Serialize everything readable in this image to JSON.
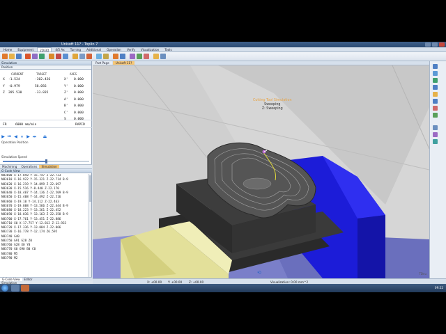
{
  "app": {
    "title": "Unisoft 11? - Toplin 7",
    "document_tab_1": "Part Page",
    "document_tab_2": "Unisoft 11?"
  },
  "ribbon": {
    "tabs": [
      {
        "label": "Home"
      },
      {
        "label": "Equipment"
      },
      {
        "label": "2D/3D"
      },
      {
        "label": "4/5 Ax"
      },
      {
        "label": "Turning"
      },
      {
        "label": "Additional"
      },
      {
        "label": "Operation"
      },
      {
        "label": "Verify"
      },
      {
        "label": "Visualization"
      },
      {
        "label": "Tools"
      }
    ]
  },
  "simulation": {
    "panel_title": "Simulation",
    "section_position": "Position",
    "col_current": "CURRENT",
    "col_target": "TARGET",
    "col_axes": "AXES",
    "rows": [
      {
        "axis": "X",
        "current": "-1.524",
        "target": "-302.426",
        "axis2": "X'",
        "value": "0.000"
      },
      {
        "axis": "Y",
        "current": "-0.979",
        "target": "58.056",
        "axis2": "Y'",
        "value": "0.000"
      },
      {
        "axis": "Z",
        "current": "205.530",
        "target": "-33.835",
        "axis2": "Z'",
        "value": "0.000"
      },
      {
        "axis": "",
        "current": "",
        "target": "",
        "axis2": "A'",
        "value": "0.000"
      },
      {
        "axis": "",
        "current": "",
        "target": "",
        "axis2": "B'",
        "value": "0.000"
      },
      {
        "axis": "",
        "current": "",
        "target": "",
        "axis2": "C'",
        "value": "0.000"
      },
      {
        "axis": "",
        "current": "",
        "target": "",
        "axis2": "S",
        "value": "0.000"
      }
    ],
    "feed_label": "FR",
    "feed_value": "6000 mm/min",
    "feed_mode": "RAPID",
    "operation_position": "Operation Position",
    "simulation_speed": "Simulation Speed",
    "speed_percent": 50
  },
  "subtabs": {
    "machining": "Machining",
    "operations": "Operations",
    "simulation": "Simulation"
  },
  "gcode": {
    "title": "G-Code View",
    "lines": [
      "N83600 X-17.850 Y-15.747 Z-22.733",
      "N83610 X-16.922 Y-15.321 Z-22.714 B-9",
      "N83620 X-16.219 Y-14.899 Z-22.697",
      "N83630 X-15.516 Y-8.440 Z-22.170",
      "N83640 X-18.407 Y-14.136 Z-22.509 B-9",
      "N83650 X-15.408 Y-14.492 Z-22.516",
      "N83660 X-19.10 Y-14.112 Z-22.463",
      "N83670 X-19.888 Y-13.566 Z-22.444 B-9",
      "N83680 X-18.223 Y-13.261 Z-22.452",
      "N83690 X-18.036 Y-13.163 Z-22.358 B-9",
      "N83700 X-17.761 Y-13.451 Z-22.886",
      "N83710 X0 X-17.757 Y-12.812 Z-12.933",
      "N83720 X-17.336 Y-13.084 Z-22.066",
      "N83730 X-16.778 Y-12.174 Z6.595",
      "N83740 G40",
      "N83750 G91 G28 Z0",
      "N83760 G28 X0 Y0",
      "N83770 G0 G90 B0 C0",
      "N83780 M5",
      "N83790 M2",
      "",
      "",
      "",
      ""
    ]
  },
  "bottomtabs": {
    "gcode": "G-Code View",
    "other": "Editor"
  },
  "statusbar": {
    "label_bottom": "Simulation",
    "x": "X: +00.00",
    "y": "Y: +00.00",
    "z": "Z: +00.00",
    "info": "Visualization: 0.00 mm^2"
  },
  "viewport": {
    "status_hint": "Cutting Tool Simulation",
    "status_line1": "Sweeping",
    "status_line2": "Z: Sweeping",
    "axis_label": "TDnu"
  },
  "taskbar": {
    "clock": "09:22"
  },
  "colors": {
    "title_bar": "#2b4a72",
    "accent_tab": "#f6c777",
    "vise_blue": "#1c1cd8",
    "vise_yellow": "#e3e09a",
    "part_gray": "#4f4f4f",
    "base_purple": "#7a7fc9"
  }
}
